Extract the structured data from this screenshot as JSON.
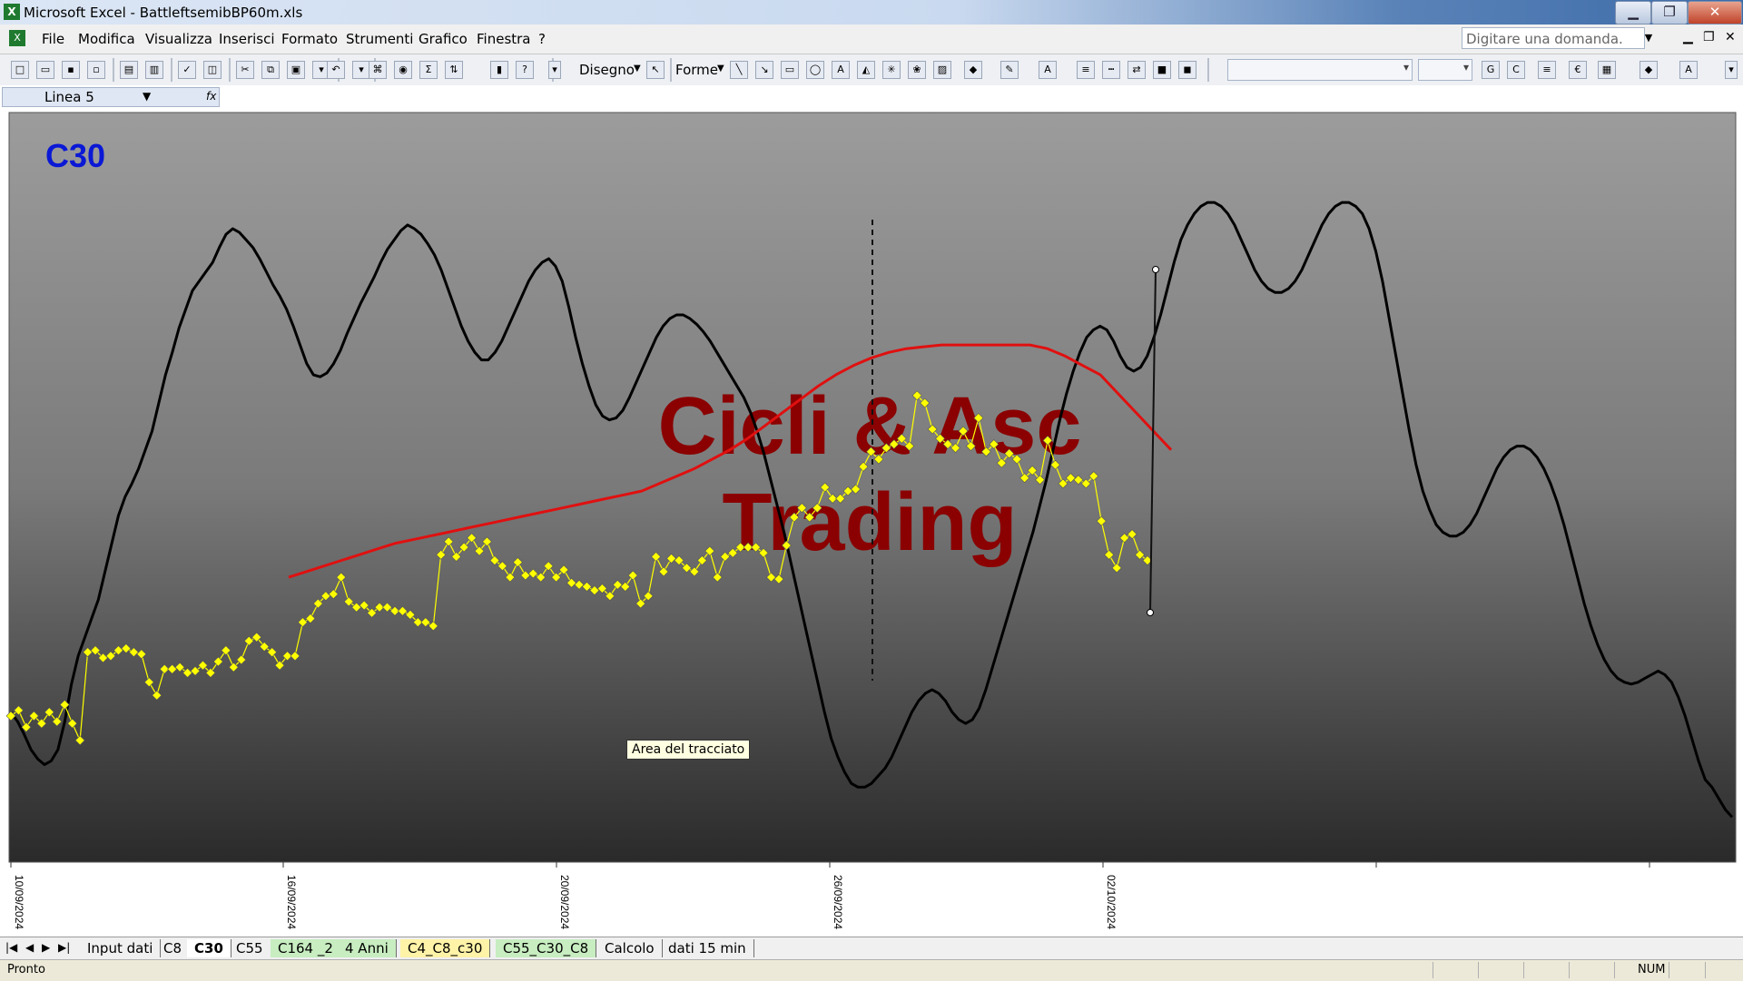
{
  "window": {
    "title": "Microsoft Excel - BattleftsemibBP60m.xls",
    "app_icon": "excel-icon"
  },
  "window_controls": [
    "minimize",
    "restore",
    "close"
  ],
  "menu": {
    "items": [
      "File",
      "Modifica",
      "Visualizza",
      "Inserisci",
      "Formato",
      "Strumenti",
      "Grafico",
      "Finestra",
      "?"
    ],
    "ask_placeholder": "Digitare una domanda."
  },
  "toolbar": {
    "disegno_label": "Disegno",
    "forme_label": "Forme"
  },
  "formula_bar": {
    "name_box": "Linea 5",
    "fx": "fx"
  },
  "chart": {
    "label": "C30",
    "label_color": "#0a18d6",
    "watermark_line1": "Cicli & Asc",
    "watermark_line2": "Trading",
    "watermark_color": "#8b0000",
    "tooltip": "Area del tracciato"
  },
  "chart_data": {
    "type": "line",
    "x_tick_labels": [
      "10/09/2024",
      "16/09/2024",
      "20/09/2024",
      "26/09/2024",
      "02/10/2024"
    ],
    "grid": false,
    "series": [
      {
        "color": "#ffff00",
        "marker": "diamond",
        "y": [
          38,
          41,
          32,
          38,
          34,
          40,
          35,
          44,
          34,
          25,
          72,
          73,
          69,
          70,
          73,
          74,
          72,
          71,
          56,
          49,
          63,
          63,
          64,
          61,
          62,
          65,
          61,
          67,
          73,
          64,
          68,
          78,
          80,
          75,
          72,
          65,
          70,
          70,
          88,
          90,
          98,
          102,
          103,
          112,
          99,
          96,
          97,
          93,
          96,
          96,
          94,
          94,
          92,
          88,
          88,
          86,
          124,
          131,
          123,
          128,
          133,
          126,
          131,
          121,
          118,
          112,
          120,
          113,
          114,
          112,
          118,
          112,
          116,
          109,
          108,
          107,
          105,
          106,
          102,
          108,
          107,
          113,
          98,
          102,
          123,
          115,
          122,
          121,
          117,
          115,
          121,
          126,
          112,
          123,
          125,
          128,
          128,
          128,
          125,
          112,
          111,
          129,
          144,
          149,
          144,
          149,
          160,
          154,
          154,
          158,
          159,
          171,
          179,
          175,
          181,
          183,
          186,
          182,
          209,
          205,
          191,
          186,
          183,
          181,
          190,
          182,
          197,
          179,
          183,
          173,
          178,
          175,
          165,
          169,
          164,
          185,
          172,
          162,
          165,
          164,
          162,
          166,
          142,
          124,
          117,
          133,
          135,
          124,
          121
        ]
      },
      {
        "color": "#e01010",
        "y": [
          112,
          115,
          118,
          121,
          124,
          127,
          130,
          132,
          134,
          136,
          138,
          140,
          142,
          144,
          146,
          148,
          150,
          152,
          154,
          156,
          158,
          162,
          166,
          170,
          175,
          180,
          186,
          193,
          200,
          207,
          214,
          220,
          225,
          229,
          232,
          234,
          235,
          236,
          236,
          236,
          236,
          236,
          236,
          234,
          230,
          225,
          220,
          210,
          200,
          190,
          180
        ]
      },
      {
        "color": "#000000",
        "y": [
          40,
          35,
          28,
          20,
          15,
          12,
          14,
          20,
          35,
          55,
          70,
          80,
          90,
          100,
          115,
          130,
          145,
          155,
          162,
          170,
          180,
          190,
          205,
          220,
          232,
          245,
          255,
          265,
          270,
          275,
          280,
          288,
          295,
          298,
          296,
          292,
          288,
          282,
          275,
          268,
          262,
          255,
          246,
          236,
          226,
          220,
          219,
          221,
          226,
          233,
          242,
          250,
          258,
          265,
          272,
          280,
          287,
          292,
          297,
          300,
          298,
          295,
          290,
          284,
          276,
          266,
          256,
          246,
          238,
          232,
          228,
          228,
          232,
          238,
          246,
          254,
          262,
          270,
          276,
          280,
          282,
          278,
          270,
          256,
          240,
          226,
          214,
          204,
          198,
          196,
          197,
          201,
          208,
          216,
          224,
          232,
          240,
          246,
          250,
          252,
          252,
          250,
          247,
          243,
          238,
          232,
          226,
          220,
          214,
          208,
          200,
          190,
          178,
          164,
          150,
          136,
          120,
          104,
          88,
          72,
          56,
          40,
          26,
          16,
          8,
          2,
          0,
          0,
          2,
          6,
          10,
          16,
          24,
          32,
          40,
          46,
          50,
          52,
          50,
          46,
          40,
          36,
          34,
          36,
          42,
          52,
          64,
          76,
          88,
          100,
          112,
          124,
          136,
          150,
          164,
          180,
          196,
          210,
          222,
          232,
          240,
          244,
          246,
          244,
          238,
          230,
          224,
          222,
          224,
          230,
          240,
          252,
          266,
          280,
          292,
          300,
          306,
          310,
          312,
          312,
          310,
          306,
          300,
          292,
          284,
          276,
          270,
          266,
          264,
          264,
          266,
          270,
          276,
          284,
          292,
          300,
          306,
          310,
          312,
          312,
          310,
          306,
          298,
          286,
          270,
          250,
          230,
          210,
          190,
          172,
          158,
          148,
          140,
          136,
          134,
          134,
          136,
          140,
          146,
          154,
          162,
          170,
          176,
          180,
          182,
          182,
          180,
          176,
          170,
          162,
          152,
          140,
          126,
          112,
          98,
          86,
          76,
          68,
          62,
          58,
          56,
          55,
          56,
          58,
          60,
          62,
          60,
          56,
          48,
          38,
          26,
          14,
          4,
          0,
          -6,
          -12,
          -16
        ]
      }
    ],
    "y_range": [
      -40,
      360
    ],
    "legend": "none"
  },
  "tabs": [
    "Input dati",
    "C8",
    "C30",
    "C55",
    "C164 _2",
    "4 Anni",
    "C4_C8_c30",
    "C55_C30_C8",
    "Calcolo",
    "dati 15 min"
  ],
  "active_tab": "C30",
  "status": {
    "left": "Pronto",
    "num": "NUM"
  }
}
